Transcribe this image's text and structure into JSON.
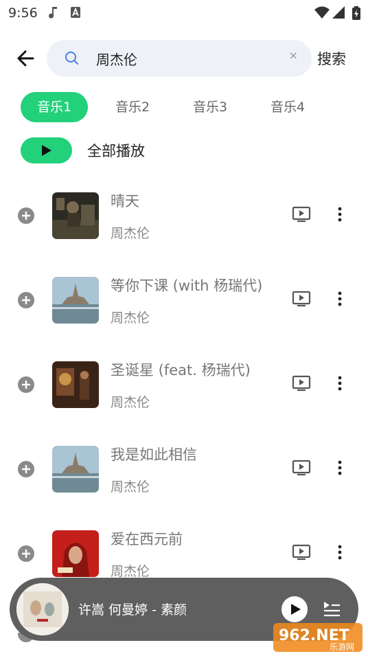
{
  "status_bar": {
    "time": "9:56"
  },
  "search": {
    "query": "周杰伦",
    "clear_label": "×",
    "submit_label": "搜索"
  },
  "tabs": [
    {
      "label": "音乐1",
      "active": true
    },
    {
      "label": "音乐2",
      "active": false
    },
    {
      "label": "音乐3",
      "active": false
    },
    {
      "label": "音乐4",
      "active": false
    }
  ],
  "play_all_label": "全部播放",
  "songs": [
    {
      "title": "晴天",
      "artist": "周杰伦",
      "cover": "dark-studio"
    },
    {
      "title": "等你下课 (with 杨瑞代)",
      "artist": "周杰伦",
      "cover": "castle-sea"
    },
    {
      "title": "圣诞星 (feat. 杨瑞代)",
      "artist": "周杰伦",
      "cover": "christmas-room"
    },
    {
      "title": "我是如此相信",
      "artist": "周杰伦",
      "cover": "castle-sea"
    },
    {
      "title": "爱在西元前",
      "artist": "周杰伦",
      "cover": "red-hood"
    }
  ],
  "now_playing": {
    "text": "许嵩 何曼婷 - 素颜"
  },
  "watermark": {
    "line1": "962.NET",
    "line2": "乐游网"
  },
  "colors": {
    "accent": "#22d17a",
    "player_bg": "#5f5f5f",
    "search_bg": "#eef2f8"
  }
}
